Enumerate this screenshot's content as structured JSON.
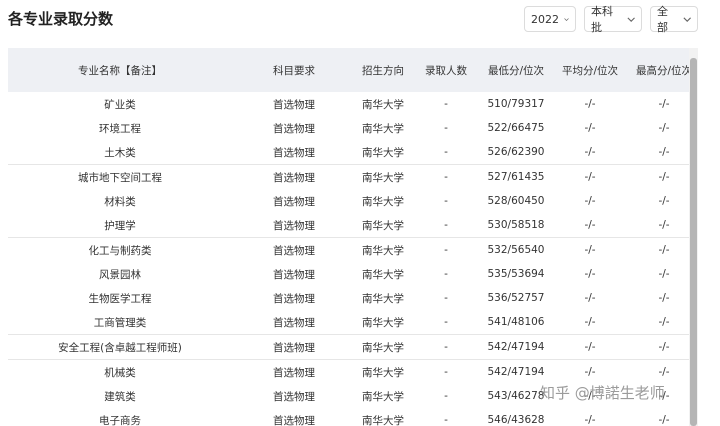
{
  "title": "各专业录取分数",
  "filters": {
    "year": "2022",
    "batch": "本科批",
    "scope": "全部"
  },
  "table": {
    "headers": [
      "专业名称【备注】",
      "科目要求",
      "招生方向",
      "录取人数",
      "最低分/位次",
      "平均分/位次",
      "最高分/位次"
    ],
    "rows": [
      [
        "矿业类",
        "首选物理",
        "南华大学",
        "-",
        "510/79317",
        "-/-",
        "-/-"
      ],
      [
        "环境工程",
        "首选物理",
        "南华大学",
        "-",
        "522/66475",
        "-/-",
        "-/-"
      ],
      [
        "土木类",
        "首选物理",
        "南华大学",
        "-",
        "526/62390",
        "-/-",
        "-/-"
      ],
      [
        "城市地下空间工程",
        "首选物理",
        "南华大学",
        "-",
        "527/61435",
        "-/-",
        "-/-"
      ],
      [
        "材料类",
        "首选物理",
        "南华大学",
        "-",
        "528/60450",
        "-/-",
        "-/-"
      ],
      [
        "护理学",
        "首选物理",
        "南华大学",
        "-",
        "530/58518",
        "-/-",
        "-/-"
      ],
      [
        "化工与制药类",
        "首选物理",
        "南华大学",
        "-",
        "532/56540",
        "-/-",
        "-/-"
      ],
      [
        "风景园林",
        "首选物理",
        "南华大学",
        "-",
        "535/53694",
        "-/-",
        "-/-"
      ],
      [
        "生物医学工程",
        "首选物理",
        "南华大学",
        "-",
        "536/52757",
        "-/-",
        "-/-"
      ],
      [
        "工商管理类",
        "首选物理",
        "南华大学",
        "-",
        "541/48106",
        "-/-",
        "-/-"
      ],
      [
        "安全工程(含卓越工程师班)",
        "首选物理",
        "南华大学",
        "-",
        "542/47194",
        "-/-",
        "-/-"
      ],
      [
        "机械类",
        "首选物理",
        "南华大学",
        "-",
        "542/47194",
        "-/-",
        "-/-"
      ],
      [
        "建筑类",
        "首选物理",
        "南华大学",
        "-",
        "543/46278",
        "-/-",
        "-/-"
      ],
      [
        "电子商务",
        "首选物理",
        "南华大学",
        "-",
        "546/43628",
        "-/-",
        "-/-"
      ]
    ]
  },
  "watermark": "知乎 @博諾生老师"
}
